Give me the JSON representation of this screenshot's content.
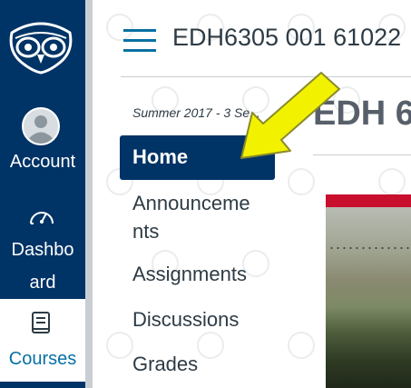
{
  "global_nav": {
    "account_label": "Account",
    "dashboard_label": "Dashbo\nard",
    "courses_label": "Courses",
    "colors": {
      "background": "#003366",
      "active_bg": "#ffffff",
      "active_text": "#0770a3"
    }
  },
  "header": {
    "breadcrumb": "EDH6305 001 61022"
  },
  "course_nav": {
    "term": "Summer 2017 - 3 Se...",
    "items": [
      {
        "label": "Home",
        "active": true
      },
      {
        "label": "Announceme\nnts",
        "active": false
      },
      {
        "label": "Assignments",
        "active": false
      },
      {
        "label": "Discussions",
        "active": false
      },
      {
        "label": "Grades",
        "active": false
      }
    ]
  },
  "main": {
    "page_title": "EDH 6"
  },
  "annotation": {
    "arrow_color": "#f2f200",
    "icon": "arrow-pointer-icon"
  }
}
